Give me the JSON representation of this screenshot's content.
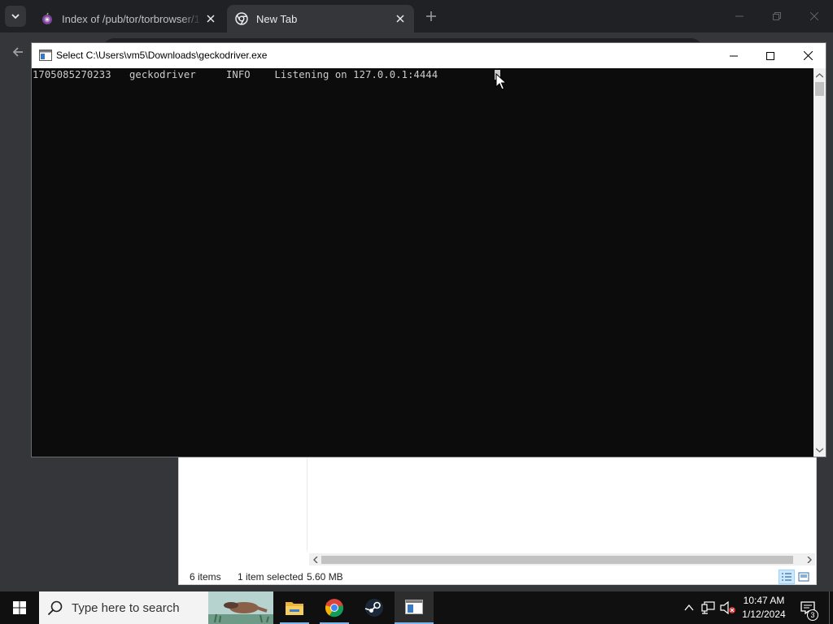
{
  "browser": {
    "tabs": [
      {
        "title": "Index of /pub/tor/torbrowser/1",
        "favicon": "tor-onion-icon",
        "active": false
      },
      {
        "title": "New Tab",
        "favicon": "chrome-icon",
        "active": true
      }
    ],
    "new_tab_icon": "plus-icon",
    "window_controls": [
      "minimize-icon",
      "restore-icon",
      "close-icon"
    ]
  },
  "console": {
    "title": "Select C:\\Users\\vm5\\Downloads\\geckodriver.exe",
    "output_line": "1705085270233   geckodriver     INFO    Listening on 127.0.0.1:4444",
    "background_color": "#0c0c0c",
    "text_color": "#cccccc"
  },
  "explorer": {
    "status_items": "6 items",
    "status_selected": "1 item selected",
    "status_size": "5.60 MB",
    "view_buttons": [
      "details-view-icon",
      "large-icons-view-icon"
    ]
  },
  "taskbar": {
    "search_placeholder": "Type here to search",
    "apps": [
      "file-explorer-icon",
      "chrome-icon",
      "steam-icon",
      "console-icon"
    ],
    "time": "10:47 AM",
    "date": "1/12/2024",
    "notification_count": "3"
  }
}
